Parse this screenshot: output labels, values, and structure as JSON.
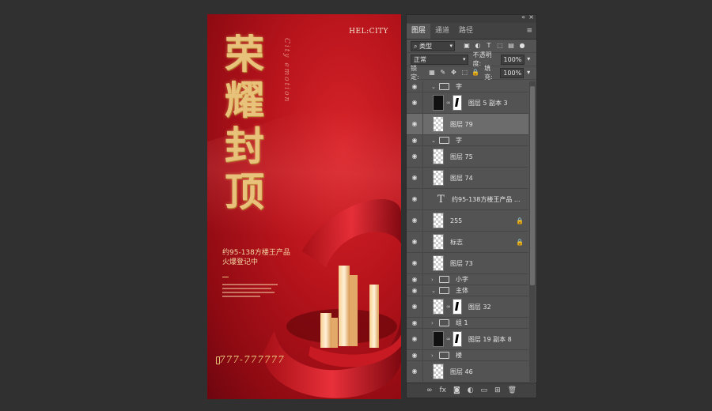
{
  "poster": {
    "brand": "HEL:CITY",
    "title_chars": [
      "荣",
      "耀",
      "封",
      "顶"
    ],
    "script": "City emotion",
    "sub1": "约95-138方楼王产品",
    "sub2": "火爆登记中",
    "phone": "777-777777",
    "colors": {
      "bg": "#b8141c",
      "gold": "#e8c27a"
    }
  },
  "panel": {
    "tabs": [
      "图层",
      "通道",
      "路径"
    ],
    "filter": {
      "label": "类型",
      "icon": "search-icon"
    },
    "blend_mode": "正常",
    "opacity_label": "不透明度:",
    "opacity_value": "100%",
    "lock_label": "锁定:",
    "fill_label": "填充:",
    "fill_value": "100%",
    "layers": [
      {
        "type": "group",
        "name": "字",
        "expanded": true
      },
      {
        "type": "masked",
        "name": "图层 5 副本 3"
      },
      {
        "type": "layer",
        "name": "图层 79",
        "selected": true
      },
      {
        "type": "group",
        "name": "字",
        "expanded": true
      },
      {
        "type": "layer",
        "name": "图层 75"
      },
      {
        "type": "layer",
        "name": "图层 74"
      },
      {
        "type": "text",
        "name": "约95-138方楼王产品 ..."
      },
      {
        "type": "layer",
        "name": "255",
        "locked": true
      },
      {
        "type": "layer",
        "name": "标志",
        "locked": true
      },
      {
        "type": "layer",
        "name": "图层 73"
      },
      {
        "type": "group",
        "name": "小字",
        "expanded": false
      },
      {
        "type": "group",
        "name": "主体",
        "expanded": true
      },
      {
        "type": "masked",
        "name": "图层 32"
      },
      {
        "type": "group",
        "name": "组 1",
        "expanded": false
      },
      {
        "type": "masked",
        "name": "图层 19 副本 8"
      },
      {
        "type": "group",
        "name": "楼",
        "expanded": false
      },
      {
        "type": "layer",
        "name": "图层 46"
      }
    ],
    "bottom_icons": [
      "link-icon",
      "fx-icon",
      "mask-icon",
      "adjustment-icon",
      "folder-icon",
      "new-layer-icon",
      "trash-icon"
    ]
  }
}
